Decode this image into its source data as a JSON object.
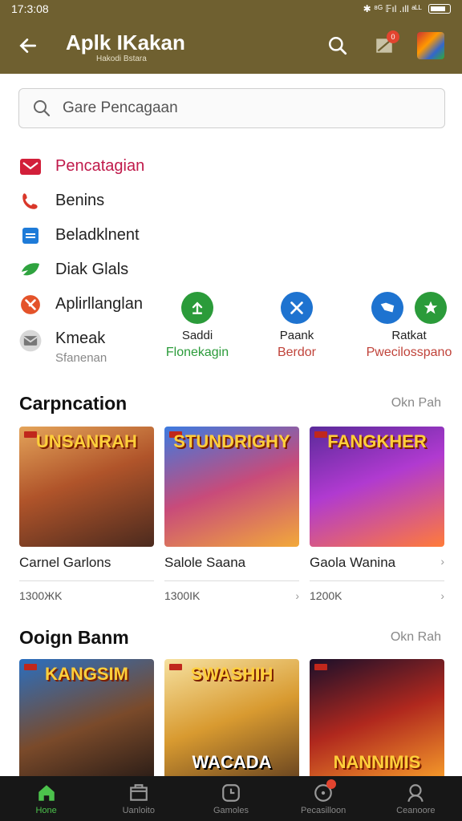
{
  "status": {
    "time": "17:3:08",
    "right": "✱ ⁸ᴳ 𝔽ıl .ıll ᵃᴸᴸ"
  },
  "header": {
    "title": "Aplk IKakan",
    "subtitle": "Hakodi Bstara"
  },
  "search": {
    "placeholder": "Gare Pencagaan"
  },
  "menu": [
    {
      "label": "Pencatagian",
      "icon": "mail-icon"
    },
    {
      "label": "Benins",
      "icon": "phone-icon"
    },
    {
      "label": "Beladklnent",
      "icon": "card-icon"
    },
    {
      "label": "Diak Glals",
      "icon": "leaf-icon"
    },
    {
      "label": "Aplirllanglan",
      "icon": "compass-icon"
    },
    {
      "label": "Kmeak",
      "sublabel": "Sfanenan",
      "icon": "envelope-icon"
    }
  ],
  "quick": [
    {
      "label": "Saddi",
      "sub": "Flonekagin",
      "color": "#2b9b3a",
      "subcolor": "#2b9b3a",
      "icon": "upload-icon"
    },
    {
      "label": "Paank",
      "sub": "Berdor",
      "color": "#1e73d0",
      "subcolor": "#c0433a",
      "icon": "shuffle-icon"
    },
    {
      "label": "Ratkat",
      "sub": "Pwecilosspano",
      "color": "#1e73d0",
      "subcolor": "#c0433a",
      "icon": "folder-icon"
    },
    {
      "label": "",
      "sub": "",
      "color": "#2b9b3a",
      "subcolor": "#c0433a",
      "icon": "star-icon"
    }
  ],
  "sections": [
    {
      "title": "Carpncation",
      "more": "Okn Pah",
      "cards": [
        {
          "art": "UNSANRAH",
          "name": "Carnel Garlons",
          "value": "1300ЖK",
          "bg": "linear-gradient(160deg,#e4a45a 0%,#b0542a 45%,#4b2a1e 100%)"
        },
        {
          "art": "STUNDRIGHY",
          "name": "Salole Saana",
          "value": "1300IK",
          "bg": "linear-gradient(160deg,#3d7be0 0%,#c84b7a 50%,#f2a93a 100%)"
        },
        {
          "art": "FANGKHER",
          "name": "Gaola Wanina",
          "value": "1200K",
          "bg": "linear-gradient(160deg,#5a2a9a 0%,#b03ad0 45%,#ff7b3a 100%)"
        }
      ]
    },
    {
      "title": "Ooign Banm",
      "more": "Okn Rah",
      "cards": [
        {
          "art": "KANGSIM",
          "name": "",
          "value": "",
          "bg": "linear-gradient(160deg,#2a6fc0 0%,#7a4a2a 55%,#2b1d17 100%)"
        },
        {
          "art": "SWASHIH",
          "name": "",
          "value": "",
          "bg": "linear-gradient(160deg,#f6e1a0 0%,#d89a30 50%,#6a4520 100%)"
        },
        {
          "art": "NANNIMIS",
          "name": "",
          "value": "",
          "bg": "linear-gradient(160deg,#1a0f2a 0%,#b0281e 50%,#f59a2a 100%)"
        }
      ]
    }
  ],
  "cardArtBottom": "WACADA",
  "nav": [
    {
      "label": "Hone",
      "icon": "home-icon",
      "active": true
    },
    {
      "label": "Uanloito",
      "icon": "store-icon"
    },
    {
      "label": "Gamoles",
      "icon": "clock-icon"
    },
    {
      "label": "Pecasilloon",
      "icon": "badge-icon"
    },
    {
      "label": "Ceanoore",
      "icon": "profile-icon"
    }
  ]
}
